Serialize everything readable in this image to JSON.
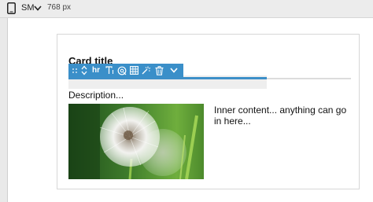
{
  "viewport_bar": {
    "device_icon": "phone-icon",
    "breakpoint": "SM",
    "width": "768 px",
    "chevron_icon": "chevron-down-icon"
  },
  "card": {
    "title": "Card title",
    "description": "Description...",
    "inner_content": "Inner content... anything can go in here...",
    "image_icon": "dandelion-photo"
  },
  "element_toolbar": {
    "selected_element_label": "hr",
    "tools": [
      "drag-handle-icon",
      "move-up-down-icon",
      "hr-label",
      "text-icon",
      "link-icon",
      "table-icon",
      "magic-wand-icon",
      "trash-icon",
      "chevron-down-icon"
    ]
  },
  "colors": {
    "accent": "#3a8fc9",
    "toolbar_bg": "#ececec",
    "canvas_bg": "#ffffff"
  }
}
